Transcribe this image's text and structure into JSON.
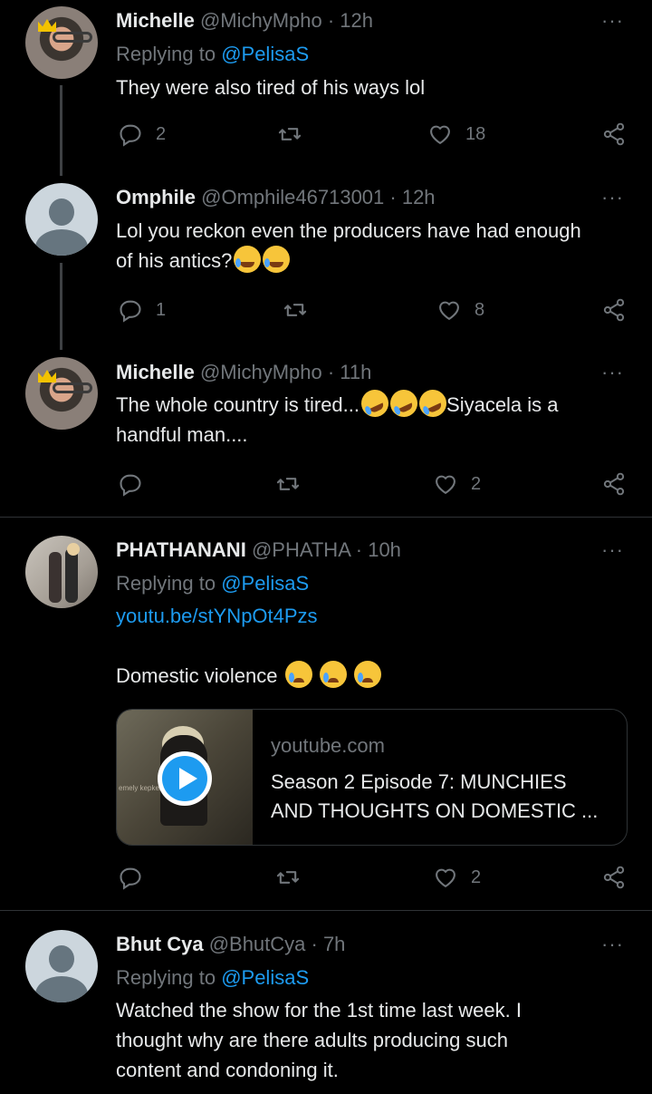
{
  "tweets": [
    {
      "name": "Michelle",
      "meta": "@MichyMpho · 12h",
      "replying_prefix": "Replying to ",
      "replying_handle": "@PelisaS",
      "text": "They were also tired of his ways lol",
      "replies": "2",
      "retweets": "",
      "likes": "18"
    },
    {
      "name": "Omphile",
      "meta": "@Omphile46713001 · 12h",
      "text_line1": "Lol you reckon even the producers have had enough",
      "text_line2": "of his antics?",
      "replies": "1",
      "retweets": "",
      "likes": "8"
    },
    {
      "name": "Michelle",
      "meta": "@MichyMpho · 11h",
      "text_part1": "The whole country is tired...",
      "text_part2": "Siyacela is a",
      "text_line2": "handful man....",
      "replies": "",
      "retweets": "",
      "likes": "2"
    },
    {
      "name": "PHATHANANI",
      "meta": "@PHATHA · 10h",
      "replying_prefix": "Replying to ",
      "replying_handle": "@PelisaS",
      "link": "youtu.be/stYNpOt4Pzs",
      "text": "Domestic violence",
      "card": {
        "domain": "youtube.com",
        "title_line1": "Season 2 Episode 7: MUNCHIES",
        "title_line2": "AND THOUGHTS ON DOMESTIC ...",
        "watermark": "emely kepkelo"
      },
      "replies": "",
      "retweets": "",
      "likes": "2"
    },
    {
      "name": "Bhut Cya",
      "meta": "@BhutCya · 7h",
      "replying_prefix": "Replying to ",
      "replying_handle": "@PelisaS",
      "text_line1": "Watched the show for the 1st time last week. I",
      "text_line2": "thought why are there adults producing such",
      "text_line3": "content and condoning it."
    }
  ],
  "more_icon": "···",
  "icons": [
    "reply-icon",
    "retweet-icon",
    "like-icon",
    "share-icon",
    "play-icon"
  ]
}
